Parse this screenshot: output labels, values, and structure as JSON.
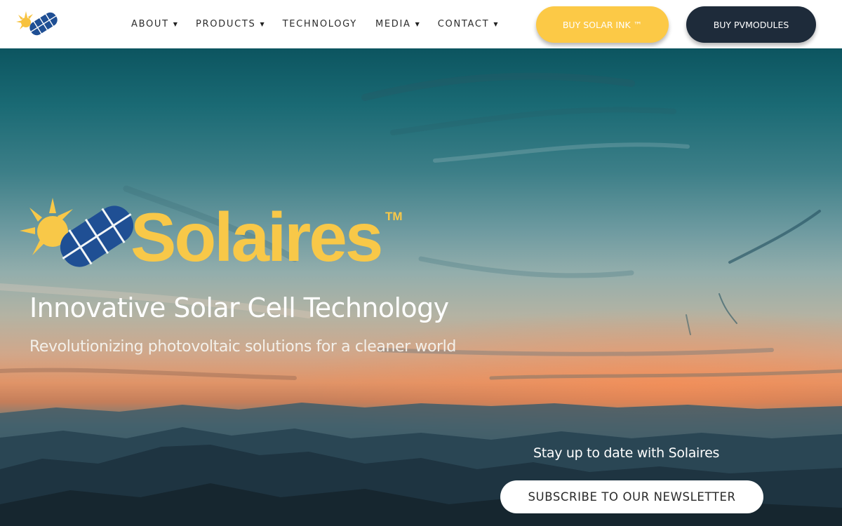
{
  "header": {
    "logo_icon": "solar-panel-sun-logo",
    "nav": [
      {
        "label": "ABOUT",
        "has_dropdown": true
      },
      {
        "label": "PRODUCTS",
        "has_dropdown": true
      },
      {
        "label": "TECHNOLOGY",
        "has_dropdown": false
      },
      {
        "label": "MEDIA",
        "has_dropdown": true
      },
      {
        "label": "CONTACT",
        "has_dropdown": true
      }
    ],
    "buy_solar_ink": "BUY SOLAR INK ™",
    "buy_pvmodules": "BUY PVMODULES"
  },
  "hero": {
    "brand_name": "Solaires",
    "trademark": "TM",
    "headline": "Innovative Solar Cell Technology",
    "subheadline": "Revolutionizing photovoltaic solutions for a cleaner world",
    "newsletter_prompt": "Stay up to date with Solaires",
    "newsletter_button": "SUBSCRIBE TO OUR NEWSLETTER"
  },
  "colors": {
    "brand_yellow": "#f8c848",
    "button_yellow": "#fcc946",
    "panel_blue": "#1f4f94",
    "dark_navy": "#1e2b3a",
    "sky_teal": "#1a6a74",
    "sunset_orange": "#e09468"
  }
}
